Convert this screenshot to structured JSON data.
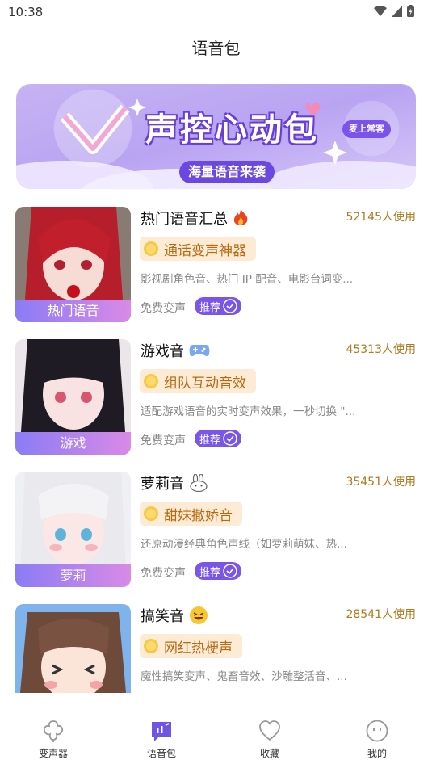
{
  "status": {
    "time": "10:38"
  },
  "page": {
    "title": "语音包"
  },
  "banner": {
    "title": "声控心动包",
    "subtitle": "海量语音来袭",
    "badge": "麦上常客"
  },
  "items": [
    {
      "thumb_label": "热门语音",
      "title": "热门语音汇总",
      "title_icon": "fire-icon",
      "usage": "52145人使用",
      "feature": "通话变声神器",
      "description": "影视剧角色音、热门 IP 配音、电影台词变...",
      "free_label": "免费变声",
      "recommend_label": "推荐"
    },
    {
      "thumb_label": "游戏",
      "title": "游戏音",
      "title_icon": "gamepad-icon",
      "usage": "45313人使用",
      "feature": "组队互动音效",
      "description": "适配游戏语音的实时变声效果，一秒切换 \"...",
      "free_label": "免费变声",
      "recommend_label": "推荐"
    },
    {
      "thumb_label": "萝莉",
      "title": "萝莉音",
      "title_icon": "bunny-icon",
      "usage": "35451人使用",
      "feature": "甜妹撒娇音",
      "description": "还原动漫经典角色声线（如萝莉萌妹、热...",
      "free_label": "免费变声",
      "recommend_label": "推荐"
    },
    {
      "thumb_label": "",
      "title": "搞笑音",
      "title_icon": "laughing-face-icon",
      "usage": "28541人使用",
      "feature": "网红热梗声",
      "description": "魔性搞笑变声、鬼畜音效、沙雕整活音、..."
    }
  ],
  "tabs": [
    {
      "label": "变声器",
      "icon": "voice-changer-icon"
    },
    {
      "label": "语音包",
      "icon": "voice-pack-icon",
      "active": true
    },
    {
      "label": "收藏",
      "icon": "heart-icon"
    },
    {
      "label": "我的",
      "icon": "profile-icon"
    }
  ],
  "colors": {
    "accent": "#7a56e8",
    "usage": "#b07a1f",
    "feature_bg": "#fdebd5",
    "feature_text": "#b66a10"
  }
}
